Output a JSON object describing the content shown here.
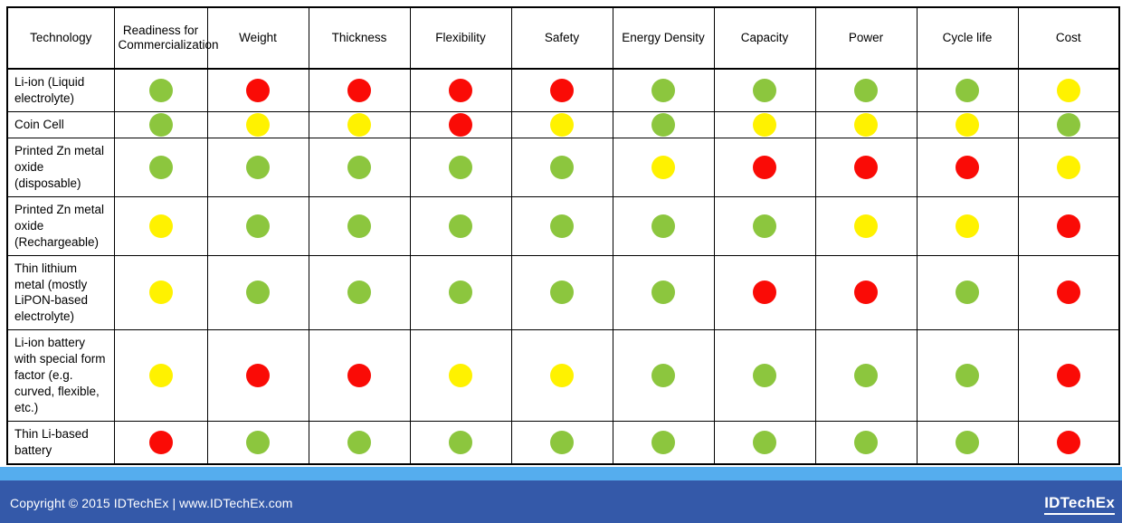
{
  "table": {
    "columns": [
      "Technology",
      "Readiness for Commercialization",
      "Weight",
      "Thickness",
      "Flexibility",
      "Safety",
      "Energy Density",
      "Capacity",
      "Power",
      "Cycle life",
      "Cost"
    ],
    "rows": [
      {
        "technology": "Li-ion (Liquid electrolyte)",
        "ratings": [
          "green",
          "red",
          "red",
          "red",
          "red",
          "green",
          "green",
          "green",
          "green",
          "yellow"
        ]
      },
      {
        "technology": "Coin Cell",
        "ratings": [
          "green",
          "yellow",
          "yellow",
          "red",
          "yellow",
          "green",
          "yellow",
          "yellow",
          "yellow",
          "green"
        ]
      },
      {
        "technology": "Printed Zn metal oxide (disposable)",
        "ratings": [
          "green",
          "green",
          "green",
          "green",
          "green",
          "yellow",
          "red",
          "red",
          "red",
          "yellow"
        ]
      },
      {
        "technology": "Printed Zn metal oxide (Rechargeable)",
        "ratings": [
          "yellow",
          "green",
          "green",
          "green",
          "green",
          "green",
          "green",
          "yellow",
          "yellow",
          "red"
        ]
      },
      {
        "technology": "Thin lithium metal (mostly LiPON-based electrolyte)",
        "ratings": [
          "yellow",
          "green",
          "green",
          "green",
          "green",
          "green",
          "red",
          "red",
          "green",
          "red"
        ]
      },
      {
        "technology": "Li-ion battery with special form factor (e.g. curved, flexible, etc.)",
        "ratings": [
          "yellow",
          "red",
          "red",
          "yellow",
          "yellow",
          "green",
          "green",
          "green",
          "green",
          "red"
        ]
      },
      {
        "technology": "Thin Li-based battery",
        "ratings": [
          "red",
          "green",
          "green",
          "green",
          "green",
          "green",
          "green",
          "green",
          "green",
          "red"
        ]
      }
    ]
  },
  "legend_colors": {
    "green": "#8CC63E",
    "red": "#FA0B06",
    "yellow": "#FFF200"
  },
  "footer": {
    "copyright": "Copyright © 2015 IDTechEx  |  www.IDTechEx.com",
    "logo": "IDTechEx",
    "stripe_color": "#55ADEE",
    "bar_color": "#3459A9"
  }
}
